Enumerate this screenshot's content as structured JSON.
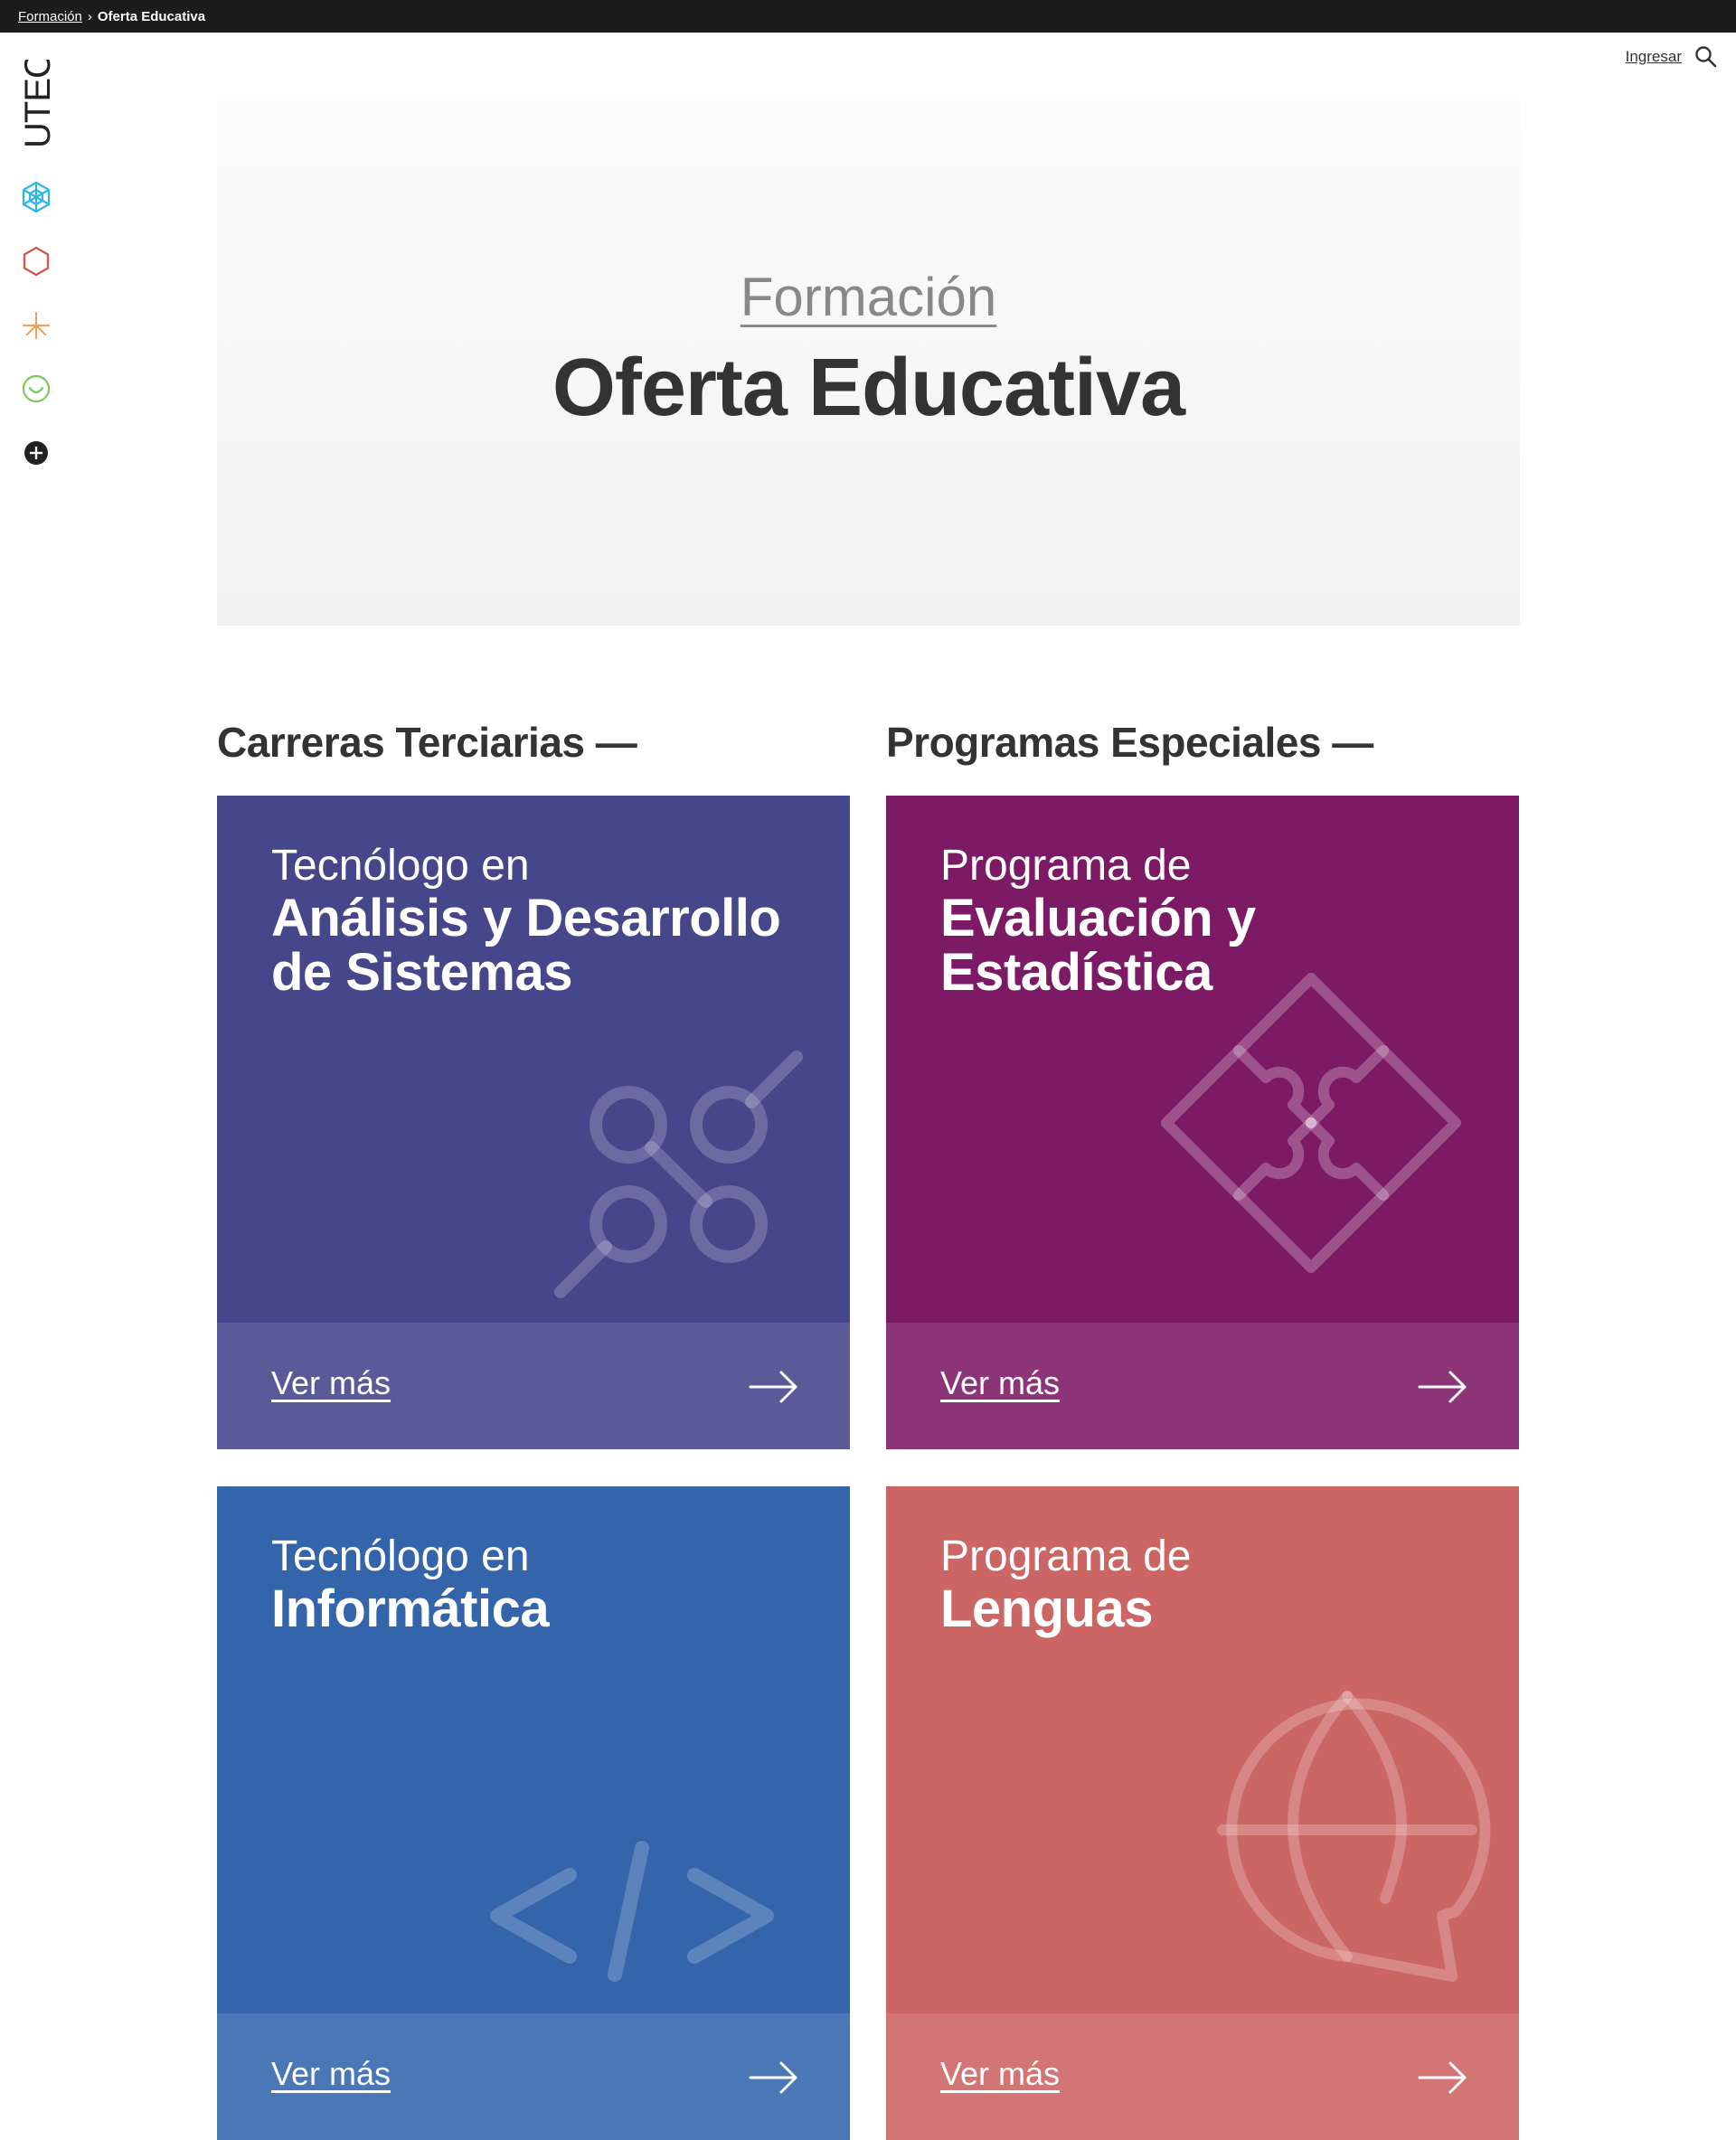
{
  "breadcrumb": {
    "parent": "Formación",
    "separator": "›",
    "current": "Oferta Educativa"
  },
  "logo": {
    "text": "UTEC"
  },
  "sidebar": {
    "items": [
      {
        "icon": "snowflake-cube-icon",
        "color": "#2fb5e6"
      },
      {
        "icon": "hexagon-icon",
        "color": "#d0584f"
      },
      {
        "icon": "asterisk-icon",
        "color": "#f0a35e"
      },
      {
        "icon": "smile-circle-icon",
        "color": "#7dc75f"
      },
      {
        "icon": "plus-circle-icon",
        "color": "#222222"
      }
    ]
  },
  "header": {
    "login": "Ingresar",
    "search_icon": "search-icon"
  },
  "hero": {
    "kicker": "Formación",
    "title": "Oferta Educativa"
  },
  "sections": [
    {
      "title": "Carreras Terciarias —"
    },
    {
      "title": "Programas Especiales —"
    }
  ],
  "cards": [
    {
      "pre": "Tecnólogo en",
      "main": "Análisis y Desarrollo de Sistemas",
      "more": "Ver más",
      "icon": "nodes-icon",
      "bg": "#46468a",
      "footer_bg": "#5b5a99"
    },
    {
      "pre": "Programa de",
      "main": "Evaluación y Estadística",
      "more": "Ver más",
      "icon": "puzzle-icon",
      "bg": "#7d1a66",
      "footer_bg": "#8c3478"
    },
    {
      "pre": "Tecnólogo en",
      "main": "Informática",
      "more": "Ver más",
      "icon": "code-icon",
      "bg": "#3465aa",
      "footer_bg": "#4a77b6"
    },
    {
      "pre": "Programa de",
      "main": "Lenguas",
      "more": "Ver más",
      "icon": "globe-chat-icon",
      "bg": "#cb6665",
      "footer_bg": "#d27574"
    }
  ]
}
